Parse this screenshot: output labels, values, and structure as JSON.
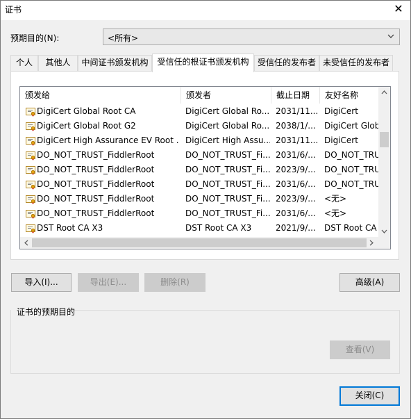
{
  "window": {
    "title": "证书",
    "close_glyph": "✕"
  },
  "purpose": {
    "label": "预期目的(N):",
    "selected": "<所有>"
  },
  "tabs": [
    {
      "label": "个人"
    },
    {
      "label": "其他人"
    },
    {
      "label": "中间证书颁发机构"
    },
    {
      "label": "受信任的根证书颁发机构"
    },
    {
      "label": "受信任的发布者"
    },
    {
      "label": "未受信任的发布者"
    }
  ],
  "list": {
    "columns": [
      "颁发给",
      "颁发者",
      "截止日期",
      "友好名称"
    ],
    "rows": [
      [
        "DigiCert Global Root CA",
        "DigiCert Global Ro...",
        "2031/11...",
        "DigiCert"
      ],
      [
        "DigiCert Global Root G2",
        "DigiCert Global Ro...",
        "2038/1/...",
        "DigiCert Glob"
      ],
      [
        "DigiCert High Assurance EV Root ...",
        "DigiCert High Assu...",
        "2031/11...",
        "DigiCert"
      ],
      [
        "DO_NOT_TRUST_FiddlerRoot",
        "DO_NOT_TRUST_Fi...",
        "2031/6/...",
        "DO_NOT_TRU"
      ],
      [
        "DO_NOT_TRUST_FiddlerRoot",
        "DO_NOT_TRUST_Fi...",
        "2023/9/...",
        "DO_NOT_TRU"
      ],
      [
        "DO_NOT_TRUST_FiddlerRoot",
        "DO_NOT_TRUST_Fi...",
        "2031/6/...",
        "DO_NOT_TRU"
      ],
      [
        "DO_NOT_TRUST_FiddlerRoot",
        "DO_NOT_TRUST_Fi...",
        "2023/9/...",
        "<无>"
      ],
      [
        "DO_NOT_TRUST_FiddlerRoot",
        "DO_NOT_TRUST_Fi...",
        "2031/6/...",
        "<无>"
      ],
      [
        "DST Root CA X3",
        "DST Root CA X3",
        "2021/9/...",
        "DST Root CA"
      ]
    ]
  },
  "buttons": {
    "import": "导入(I)...",
    "export": "导出(E)...",
    "remove": "删除(R)",
    "advanced": "高级(A)",
    "view": "查看(V)",
    "close": "关闭(C)"
  },
  "purposes_group": {
    "label": "证书的预期目的"
  }
}
